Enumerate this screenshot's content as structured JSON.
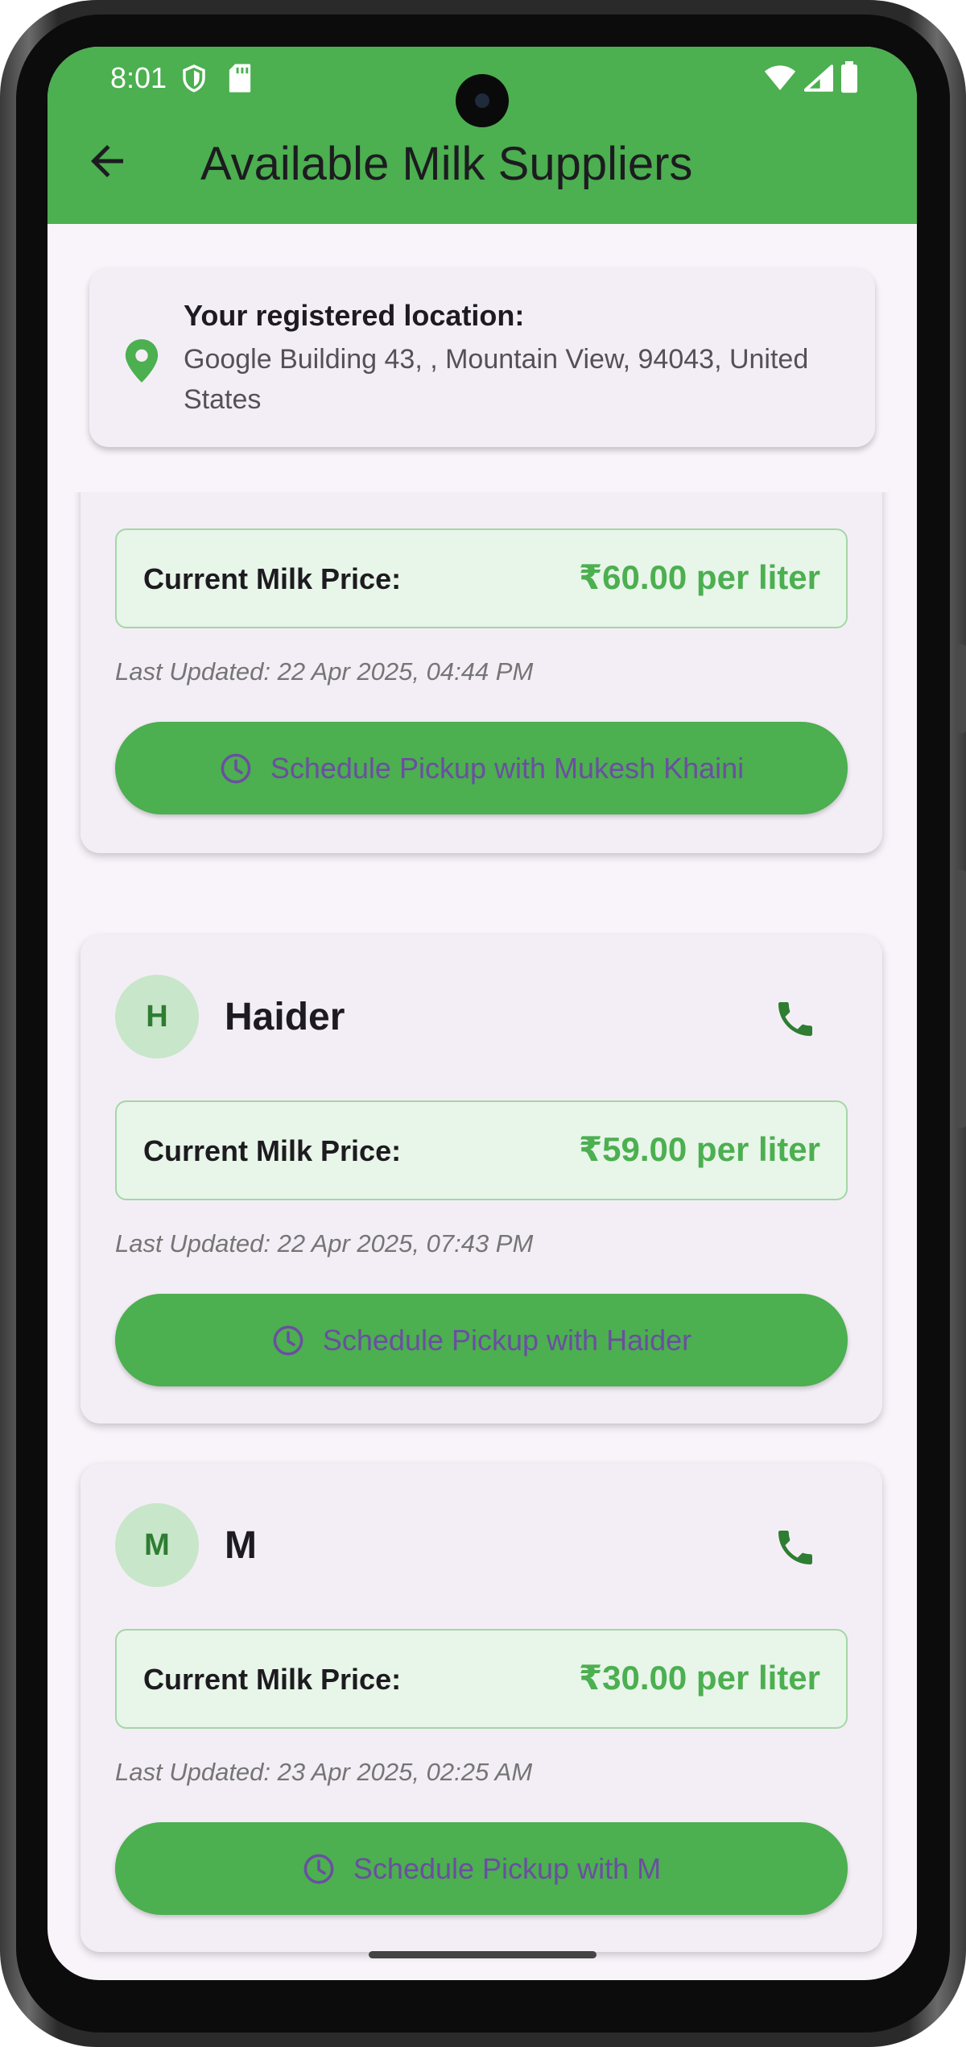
{
  "status_bar": {
    "time": "8:01",
    "icons": [
      "shield-icon",
      "sd-card-icon",
      "wifi-icon",
      "signal-icon",
      "battery-icon"
    ]
  },
  "app_bar": {
    "title": "Available Milk Suppliers",
    "back_icon": "arrow-back-icon",
    "background_color": "#4caf50"
  },
  "location": {
    "label": "Your registered location:",
    "address": "Google Building 43, , Mountain View, 94043, United States",
    "icon": "location-pin-icon"
  },
  "suppliers": [
    {
      "name": "Mukesh Khaini",
      "initial": "",
      "price_label": "Current Milk Price:",
      "price": "₹60.00 per liter",
      "last_updated": "Last Updated: 22 Apr 2025, 04:44 PM",
      "button_label": "Schedule Pickup with Mukesh Khaini"
    },
    {
      "name": "Haider",
      "initial": "H",
      "price_label": "Current Milk Price:",
      "price": "₹59.00 per liter",
      "last_updated": "Last Updated: 22 Apr 2025, 07:43 PM",
      "button_label": "Schedule Pickup with Haider"
    },
    {
      "name": "M",
      "initial": "M",
      "price_label": "Current Milk Price:",
      "price": "₹30.00 per liter",
      "last_updated": "Last Updated: 23 Apr 2025, 02:25 AM",
      "button_label": "Schedule Pickup with M"
    }
  ],
  "colors": {
    "primary_green": "#4caf50",
    "price_box_bg": "#e8f5e9",
    "button_text": "#6a4fa0",
    "card_bg": "#f3eef5",
    "screen_bg": "#f9f3fa"
  }
}
